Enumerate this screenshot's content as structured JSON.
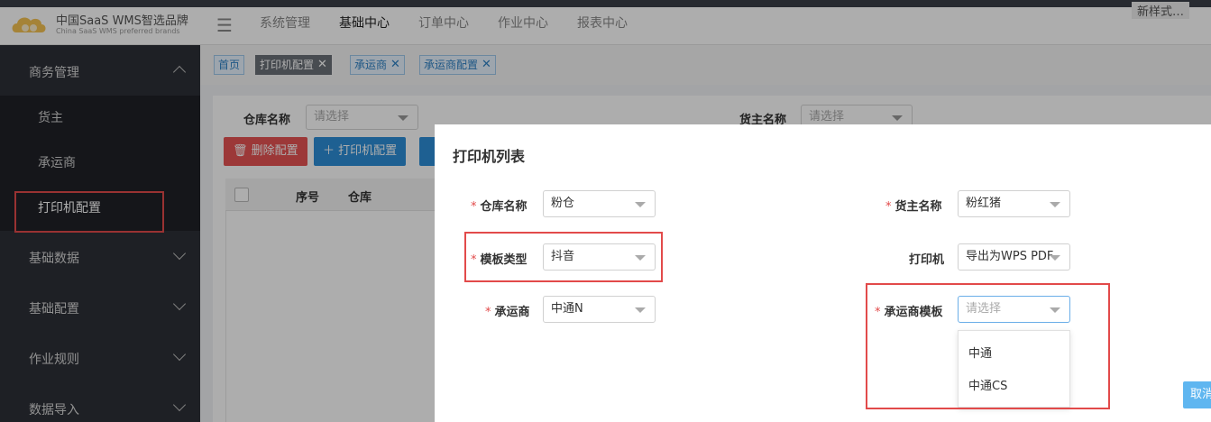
{
  "app": {
    "logo_title": "中国SaaS WMS智选品牌",
    "logo_subtitle": "China SaaS WMS preferred brands",
    "top_right_text": "新样式…"
  },
  "topnav": {
    "items": [
      "系统管理",
      "基础中心",
      "订单中心",
      "作业中心",
      "报表中心"
    ],
    "active": "基础中心"
  },
  "sidebar": {
    "group_business": "商务管理",
    "sub_items": [
      "货主",
      "承运商",
      "打印机配置"
    ],
    "active_sub": "打印机配置",
    "groups": [
      "基础数据",
      "基础配置",
      "作业规则",
      "数据导入"
    ]
  },
  "tags": {
    "home": "首页",
    "items": [
      "打印机配置",
      "承运商",
      "承运商配置"
    ]
  },
  "filters": {
    "warehouse_label": "仓库名称",
    "warehouse_placeholder": "请选择",
    "owner_label": "货主名称",
    "owner_placeholder": "请选择"
  },
  "toolbar": {
    "delete_label": "删除配置",
    "add_label": "打印机配置"
  },
  "table": {
    "headers": [
      "序号",
      "仓库"
    ]
  },
  "modal": {
    "title": "打印机列表",
    "warehouse_label": "仓库名称",
    "warehouse_value": "粉仓",
    "owner_label": "货主名称",
    "owner_value": "粉红猪",
    "template_type_label": "模板类型",
    "template_type_value": "抖音",
    "printer_label": "打印机",
    "printer_value": "导出为WPS PDF",
    "carrier_label": "承运商",
    "carrier_value": "中通N",
    "carrier_template_label": "承运商模板",
    "carrier_template_placeholder": "请选择",
    "dropdown_options": [
      "中通",
      "中通CS"
    ],
    "cancel_label": "取消"
  },
  "colors": {
    "sidebar_bg": "#2d3037",
    "submenu_bg": "#1f2127",
    "highlight_red": "#e24a4a",
    "primary_blue": "#2d8ed8",
    "danger_red": "#e65353"
  }
}
